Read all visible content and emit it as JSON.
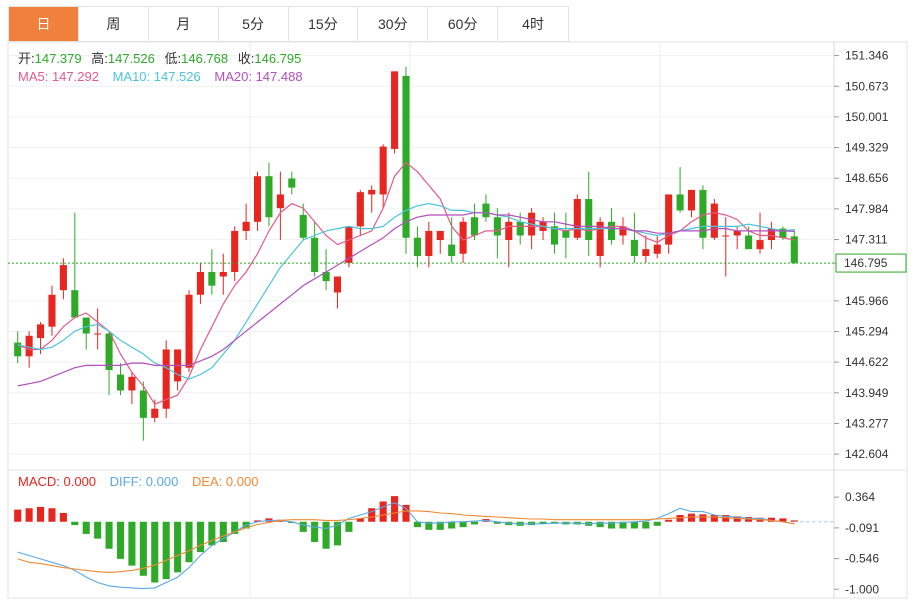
{
  "tabs": [
    "日",
    "周",
    "月",
    "5分",
    "15分",
    "30分",
    "60分",
    "4时"
  ],
  "active_tab": 0,
  "ohlc_label": {
    "open_k": "开:",
    "open_v": "147.379",
    "high_k": "高:",
    "high_v": "147.526",
    "low_k": "低:",
    "low_v": "146.768",
    "close_k": "收:",
    "close_v": "146.795"
  },
  "ma_label": {
    "ma5": "MA5: 147.292",
    "ma10": "MA10: 147.526",
    "ma20": "MA20: 147.488"
  },
  "macd_label": {
    "macd": "MACD: 0.000",
    "diff": "DIFF: 0.000",
    "dea": "DEA: 0.000"
  },
  "current_price": "146.795",
  "colors": {
    "up": "#e6261f",
    "down": "#2eaa28",
    "ma5": "#e55a8a",
    "ma10": "#4cc3de",
    "ma20": "#b34fbf",
    "dea": "#f08a34",
    "diff": "#5aa9e6",
    "accent": "#f0803c"
  },
  "chart_data": [
    {
      "type": "candlestick",
      "ylim": [
        142.3,
        151.6
      ],
      "yticks": [
        "151.346",
        "150.673",
        "150.001",
        "149.329",
        "148.656",
        "147.984",
        "147.311",
        "146.795",
        "145.966",
        "145.294",
        "144.622",
        "143.949",
        "143.277",
        "142.604"
      ],
      "candles": [
        [
          145.05,
          145.3,
          144.6,
          144.75
        ],
        [
          144.75,
          145.3,
          144.5,
          145.2
        ],
        [
          145.15,
          145.5,
          144.8,
          145.45
        ],
        [
          145.4,
          146.3,
          145.2,
          146.1
        ],
        [
          146.2,
          146.9,
          146.0,
          146.75
        ],
        [
          146.2,
          147.9,
          145.6,
          145.6
        ],
        [
          145.6,
          145.5,
          144.9,
          145.25
        ],
        [
          145.25,
          145.8,
          144.9,
          145.25
        ],
        [
          145.25,
          145.3,
          143.9,
          144.45
        ],
        [
          144.35,
          144.6,
          143.9,
          144.0
        ],
        [
          144.0,
          144.4,
          143.7,
          144.3
        ],
        [
          144.0,
          144.2,
          142.9,
          143.4
        ],
        [
          143.4,
          143.8,
          143.3,
          143.6
        ],
        [
          143.6,
          145.1,
          143.4,
          144.9
        ],
        [
          144.2,
          144.9,
          144.0,
          144.9
        ],
        [
          144.5,
          146.2,
          144.4,
          146.1
        ],
        [
          146.1,
          146.8,
          145.9,
          146.6
        ],
        [
          146.6,
          147.1,
          146.1,
          146.3
        ],
        [
          146.5,
          147.0,
          146.1,
          146.6
        ],
        [
          146.6,
          147.6,
          146.4,
          147.5
        ],
        [
          147.5,
          148.1,
          147.3,
          147.7
        ],
        [
          147.7,
          148.8,
          147.5,
          148.7
        ],
        [
          148.7,
          149.0,
          147.6,
          147.8
        ],
        [
          148.0,
          148.8,
          147.3,
          148.3
        ],
        [
          148.65,
          148.8,
          148.3,
          148.45
        ],
        [
          147.85,
          148.1,
          147.3,
          147.35
        ],
        [
          147.35,
          147.7,
          146.5,
          146.6
        ],
        [
          146.6,
          147.1,
          146.2,
          146.4
        ],
        [
          146.15,
          146.5,
          145.8,
          146.5
        ],
        [
          146.8,
          147.6,
          146.7,
          147.6
        ],
        [
          147.6,
          148.4,
          147.4,
          148.35
        ],
        [
          148.3,
          148.5,
          147.9,
          148.4
        ],
        [
          148.3,
          149.4,
          148.0,
          149.35
        ],
        [
          149.3,
          151.0,
          149.2,
          151.0
        ],
        [
          150.9,
          151.1,
          147.0,
          147.35
        ],
        [
          147.35,
          147.6,
          146.7,
          146.95
        ],
        [
          146.95,
          147.7,
          146.7,
          147.5
        ],
        [
          147.3,
          147.4,
          147.0,
          147.5
        ],
        [
          147.2,
          147.8,
          146.8,
          146.95
        ],
        [
          147.0,
          147.8,
          146.8,
          147.7
        ],
        [
          147.8,
          148.1,
          147.3,
          147.4
        ],
        [
          148.1,
          148.3,
          147.7,
          147.8
        ],
        [
          147.8,
          148.0,
          146.9,
          147.4
        ],
        [
          147.3,
          147.9,
          146.7,
          147.7
        ],
        [
          147.7,
          147.9,
          147.2,
          147.4
        ],
        [
          147.4,
          148.0,
          147.1,
          147.9
        ],
        [
          147.5,
          147.8,
          147.3,
          147.7
        ],
        [
          147.6,
          147.9,
          147.0,
          147.2
        ],
        [
          147.5,
          147.9,
          146.9,
          147.35
        ],
        [
          147.35,
          148.3,
          147.3,
          148.2
        ],
        [
          148.2,
          148.8,
          146.95,
          147.3
        ],
        [
          146.95,
          147.8,
          146.7,
          147.7
        ],
        [
          147.7,
          148.0,
          147.2,
          147.3
        ],
        [
          147.4,
          147.8,
          147.2,
          147.6
        ],
        [
          147.3,
          147.9,
          146.8,
          146.95
        ],
        [
          146.95,
          147.4,
          146.8,
          147.1
        ],
        [
          147.0,
          147.4,
          146.9,
          147.2
        ],
        [
          147.2,
          148.3,
          147.0,
          148.3
        ],
        [
          148.3,
          148.9,
          147.9,
          147.95
        ],
        [
          147.95,
          148.4,
          147.8,
          148.4
        ],
        [
          148.4,
          148.5,
          147.1,
          147.35
        ],
        [
          147.35,
          148.2,
          147.3,
          148.1
        ],
        [
          147.4,
          147.8,
          146.5,
          147.4
        ],
        [
          147.4,
          147.6,
          147.1,
          147.5
        ],
        [
          147.4,
          147.6,
          147.1,
          147.1
        ],
        [
          147.1,
          147.9,
          147.0,
          147.3
        ],
        [
          147.3,
          147.7,
          147.1,
          147.55
        ],
        [
          147.55,
          147.6,
          147.3,
          147.35
        ],
        [
          147.38,
          147.53,
          146.77,
          146.8
        ]
      ],
      "ma5": [
        145.0,
        144.9,
        144.9,
        145.1,
        145.4,
        145.6,
        145.7,
        145.5,
        145.3,
        144.8,
        144.4,
        144.1,
        143.7,
        143.8,
        143.9,
        144.3,
        144.9,
        145.4,
        145.9,
        146.3,
        146.6,
        147.0,
        147.5,
        147.9,
        148.1,
        148.0,
        147.7,
        147.4,
        147.2,
        147.3,
        147.4,
        147.5,
        148.0,
        148.7,
        149.0,
        148.8,
        148.5,
        148.2,
        147.6,
        147.3,
        147.4,
        147.5,
        147.5,
        147.6,
        147.6,
        147.6,
        147.6,
        147.55,
        147.5,
        147.55,
        147.5,
        147.55,
        147.6,
        147.6,
        147.5,
        147.35,
        147.25,
        147.4,
        147.5,
        147.7,
        147.85,
        147.9,
        147.85,
        147.75,
        147.5,
        147.4,
        147.4,
        147.35,
        147.3
      ],
      "ma10": [
        145.0,
        144.95,
        144.9,
        144.95,
        145.1,
        145.3,
        145.4,
        145.45,
        145.3,
        145.1,
        144.95,
        144.8,
        144.6,
        144.5,
        144.35,
        144.25,
        144.35,
        144.5,
        144.8,
        145.1,
        145.5,
        145.9,
        146.3,
        146.7,
        147.0,
        147.3,
        147.4,
        147.5,
        147.55,
        147.6,
        147.55,
        147.55,
        147.6,
        147.8,
        147.95,
        148.05,
        148.1,
        148.05,
        147.95,
        147.95,
        147.9,
        147.9,
        147.85,
        147.8,
        147.7,
        147.65,
        147.6,
        147.55,
        147.55,
        147.55,
        147.55,
        147.55,
        147.55,
        147.55,
        147.5,
        147.45,
        147.4,
        147.45,
        147.5,
        147.55,
        147.6,
        147.6,
        147.6,
        147.6,
        147.65,
        147.6,
        147.55,
        147.5,
        147.53
      ],
      "ma20": [
        144.1,
        144.15,
        144.2,
        144.3,
        144.4,
        144.5,
        144.55,
        144.55,
        144.55,
        144.55,
        144.6,
        144.6,
        144.55,
        144.55,
        144.55,
        144.55,
        144.65,
        144.75,
        144.9,
        145.1,
        145.3,
        145.5,
        145.7,
        145.9,
        146.1,
        146.3,
        146.45,
        146.6,
        146.75,
        146.9,
        147.05,
        147.2,
        147.35,
        147.55,
        147.7,
        147.8,
        147.85,
        147.85,
        147.85,
        147.85,
        147.9,
        147.9,
        147.85,
        147.85,
        147.8,
        147.75,
        147.7,
        147.7,
        147.65,
        147.6,
        147.6,
        147.6,
        147.55,
        147.55,
        147.5,
        147.5,
        147.45,
        147.45,
        147.5,
        147.5,
        147.5,
        147.55,
        147.55,
        147.5,
        147.5,
        147.5,
        147.5,
        147.5,
        147.49
      ]
    },
    {
      "type": "bar",
      "ylim": [
        -1.1,
        0.5
      ],
      "yticks": [
        "0.364",
        "-0.091",
        "-0.546",
        "-1.000"
      ],
      "macd": [
        0.18,
        0.2,
        0.22,
        0.2,
        0.13,
        -0.05,
        -0.18,
        -0.25,
        -0.4,
        -0.55,
        -0.65,
        -0.8,
        -0.9,
        -0.85,
        -0.75,
        -0.6,
        -0.45,
        -0.35,
        -0.3,
        -0.18,
        -0.1,
        0.02,
        0.05,
        0.03,
        -0.02,
        -0.15,
        -0.3,
        -0.4,
        -0.35,
        -0.15,
        0.05,
        0.2,
        0.3,
        0.38,
        0.25,
        -0.08,
        -0.12,
        -0.12,
        -0.1,
        -0.08,
        -0.04,
        0.04,
        -0.03,
        -0.05,
        -0.06,
        -0.05,
        -0.03,
        -0.03,
        -0.04,
        -0.04,
        -0.06,
        -0.08,
        -0.1,
        -0.1,
        -0.1,
        -0.1,
        -0.06,
        0.03,
        0.1,
        0.12,
        0.11,
        0.1,
        0.1,
        0.08,
        0.07,
        0.06,
        0.06,
        0.05,
        0.02
      ],
      "diff": [
        -0.45,
        -0.5,
        -0.55,
        -0.6,
        -0.65,
        -0.72,
        -0.82,
        -0.9,
        -0.95,
        -0.97,
        -0.98,
        -0.99,
        -0.98,
        -0.9,
        -0.82,
        -0.68,
        -0.5,
        -0.35,
        -0.25,
        -0.15,
        -0.05,
        0.0,
        0.02,
        0.02,
        0.0,
        -0.05,
        -0.08,
        -0.1,
        -0.05,
        0.05,
        0.1,
        0.15,
        0.22,
        0.28,
        0.2,
        0.0,
        -0.02,
        -0.02,
        0.0,
        0.0,
        0.01,
        0.02,
        0.0,
        -0.02,
        -0.03,
        -0.03,
        -0.03,
        -0.02,
        -0.02,
        -0.02,
        -0.03,
        -0.02,
        -0.02,
        -0.01,
        0.0,
        0.01,
        0.05,
        0.12,
        0.2,
        0.15,
        0.15,
        0.1,
        0.08,
        0.07,
        0.05,
        0.05,
        0.02,
        0.0,
        -0.03
      ],
      "dea": [
        -0.55,
        -0.6,
        -0.62,
        -0.65,
        -0.68,
        -0.7,
        -0.72,
        -0.74,
        -0.75,
        -0.74,
        -0.72,
        -0.69,
        -0.64,
        -0.57,
        -0.5,
        -0.43,
        -0.35,
        -0.28,
        -0.21,
        -0.15,
        -0.09,
        -0.04,
        -0.01,
        0.02,
        0.03,
        0.03,
        0.03,
        0.02,
        0.02,
        0.03,
        0.05,
        0.07,
        0.1,
        0.13,
        0.16,
        0.16,
        0.15,
        0.13,
        0.12,
        0.1,
        0.09,
        0.08,
        0.07,
        0.06,
        0.05,
        0.04,
        0.04,
        0.03,
        0.03,
        0.03,
        0.03,
        0.03,
        0.03,
        0.03,
        0.03,
        0.03,
        0.04,
        0.05,
        0.06,
        0.07,
        0.07,
        0.07,
        0.06,
        0.05,
        0.04,
        0.03,
        0.02,
        0.0,
        -0.03
      ]
    }
  ]
}
